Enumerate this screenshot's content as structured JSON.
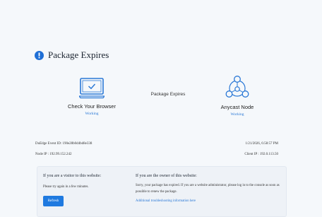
{
  "header": {
    "title": "Package Expires"
  },
  "status": {
    "browser": {
      "label": "Check Your Browser",
      "state": "Working"
    },
    "middle_label": "Package Expires",
    "node": {
      "label": "Anycast Node",
      "state": "Working"
    }
  },
  "meta": {
    "event_id": "DuEdge Event ID: 190e28b0d4bd8e338",
    "timestamp": "1/21/2026, 6:58:57 PM",
    "node_ip": "Node IP : 192.99.152.242",
    "client_ip": "Client IP : 192.0.113.50"
  },
  "visitor": {
    "heading": "If you are a visitor to this website:",
    "text": "Please try again in a few minutes.",
    "button_label": "Refresh"
  },
  "owner": {
    "heading": "If you are the owner of this website:",
    "text": "Sorry, your package has expired. If you are a website administrator, please log in to the console as soon as possible to renew the package.",
    "link_label": "Additional troubleshooting information here"
  },
  "colors": {
    "accent": "#1f7ae0",
    "status": "#2a78d6"
  }
}
